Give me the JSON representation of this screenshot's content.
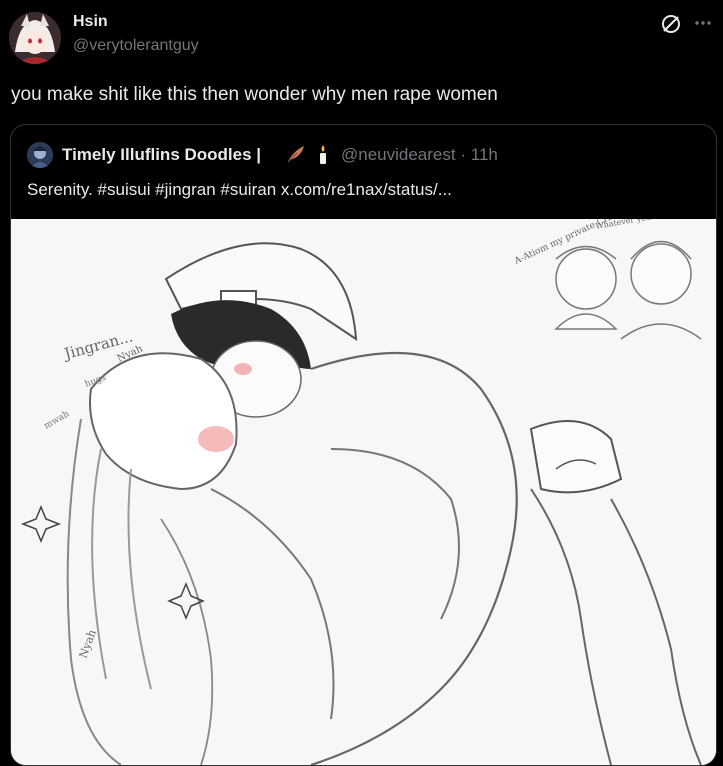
{
  "post": {
    "author_name": "Hsin",
    "author_handle": "@verytolerantguy",
    "text": "you make shit like this then wonder why men rape women"
  },
  "quoted_post": {
    "author_name": "Timely Illuflins Doodles |",
    "author_handle": "@neuvidearest",
    "separator": "·",
    "time": "11h",
    "text": "Serenity. #suisui #jingran #suiran  x.com/re1nax/status/...",
    "emojis": [
      "feather-icon",
      "candle-icon"
    ]
  },
  "image_annotations": {
    "jingran": "Jingran...",
    "mwah": "mwah",
    "hugs": "hugs",
    "nyah1": "Nyah",
    "nyah2": "Nyah",
    "aside_left": "A-Atiom my private Crimson later.",
    "aside_right": "Whatever you want my lady"
  },
  "colors": {
    "background": "#000000",
    "text_primary": "#e7e9ea",
    "text_secondary": "#71767b",
    "border": "#2f3336",
    "sketch_bg": "#f7f7f7"
  }
}
